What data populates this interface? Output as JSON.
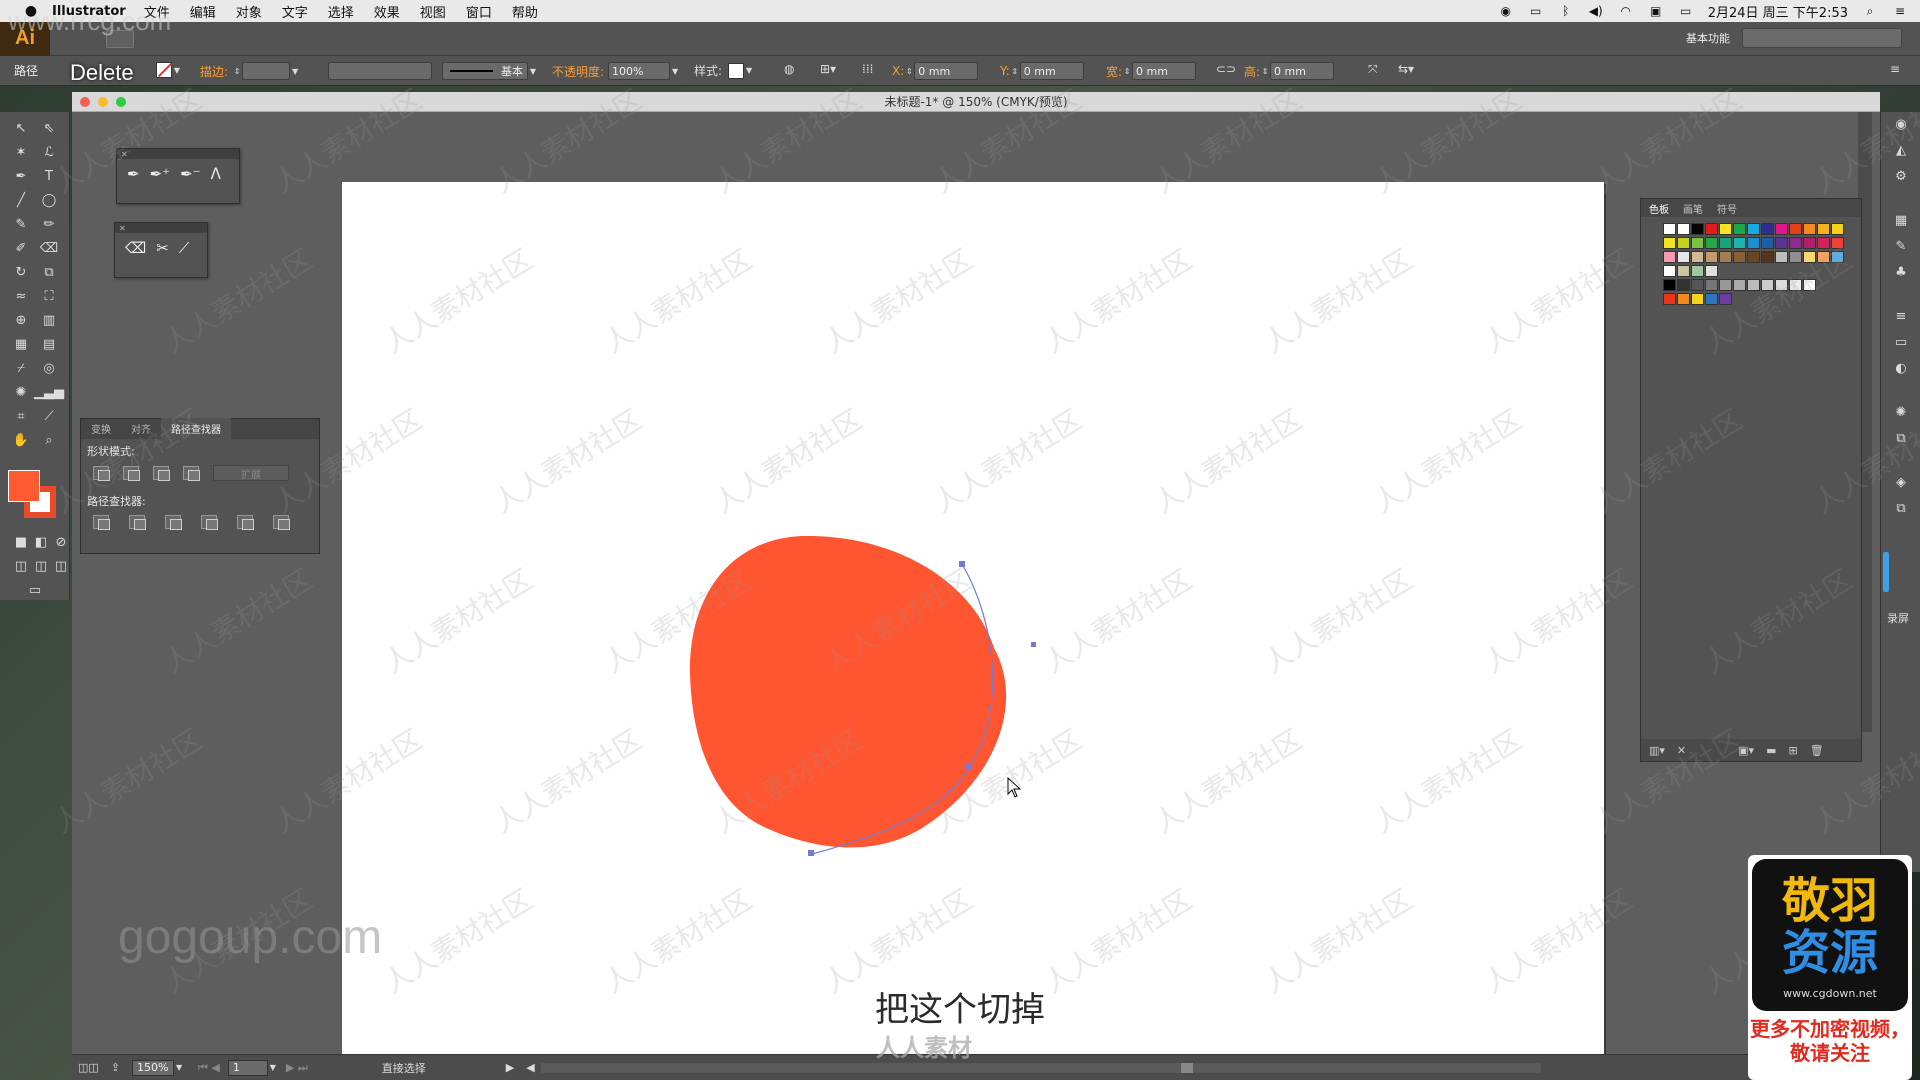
{
  "menubar": {
    "app_name": "Illustrator",
    "items": [
      "文件",
      "编辑",
      "对象",
      "文字",
      "选择",
      "效果",
      "视图",
      "窗口",
      "帮助"
    ],
    "datetime": "2月24日 周三 下午2:53"
  },
  "appbar": {
    "logo": "Ai",
    "workspace": "基本功能"
  },
  "control": {
    "selection_label": "路径",
    "key_overlay": "Delete",
    "stroke_label": "描边:",
    "brush_label": "基本",
    "opacity_label": "不透明度:",
    "opacity_value": "100%",
    "style_label": "样式:",
    "x_label": "X:",
    "x_value": "0 mm",
    "y_label": "Y:",
    "y_value": "0 mm",
    "w_label": "宽:",
    "w_value": "0 mm",
    "h_label": "高:",
    "h_value": "0 mm"
  },
  "document": {
    "title": "未标题-1* @ 150% (CMYK/预览)"
  },
  "pathfinder": {
    "tabs": [
      "变换",
      "对齐",
      "路径查找器"
    ],
    "shape_modes_label": "形状模式:",
    "expand_label": "扩展",
    "pathfinders_label": "路径查找器:"
  },
  "swatches": {
    "tabs": [
      "色板",
      "画笔",
      "符号"
    ]
  },
  "rightdock": {
    "record_label": "录屏"
  },
  "status": {
    "zoom": "150%",
    "artboard": "1",
    "tool": "直接选择"
  },
  "subtitle": "把这个切掉",
  "watermarks": {
    "top_left": "www.rrcg.com",
    "gogoup": "gogoup.com",
    "rrsc": "人人素材",
    "diagonal": "人人素材社区",
    "corner_line1": "敬羽",
    "corner_line2": "资源",
    "corner_url": "www.cgdown.net",
    "corner_note": "更多不加密视频，敬请关注"
  },
  "colors": {
    "shape_fill": "#FF5530",
    "path_stroke": "#6F7BD6",
    "ui_panel": "#535353"
  }
}
